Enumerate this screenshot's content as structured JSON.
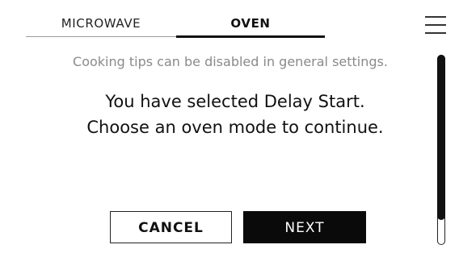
{
  "tabs": [
    {
      "label": "MICROWAVE",
      "active": false
    },
    {
      "label": "OVEN",
      "active": true
    }
  ],
  "menu": {
    "icon": "hamburger-menu-icon"
  },
  "tip": "Cooking tips can be disabled in general settings.",
  "message": {
    "line1": "You have selected Delay Start.",
    "line2": "Choose an oven mode to continue."
  },
  "buttons": {
    "cancel": "CANCEL",
    "next": "NEXT"
  },
  "colors": {
    "text": "#111111",
    "tip_text": "#8a8a8a",
    "primary_button_bg": "#0a0a0a",
    "primary_button_text": "#ffffff"
  }
}
